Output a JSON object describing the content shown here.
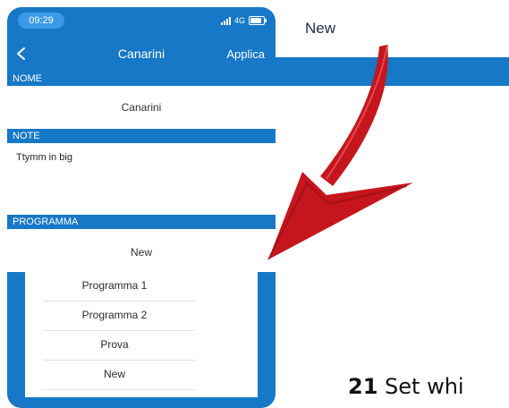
{
  "status_bar": {
    "time": "09:29",
    "network": "4G"
  },
  "nav": {
    "title": "Canarini",
    "apply_label": "Applica"
  },
  "sections": {
    "nome": {
      "label": "NOME",
      "value": "Canarini"
    },
    "note": {
      "label": "NOTE",
      "value": "Ttymm in big"
    },
    "programma": {
      "label": "PROGRAMMA",
      "value": "New"
    }
  },
  "picker": {
    "options": [
      {
        "label": "Programma 1"
      },
      {
        "label": "Programma 2"
      },
      {
        "label": "Prova"
      },
      {
        "label": "New"
      }
    ]
  },
  "zoom": {
    "title": "New"
  },
  "caption": {
    "number": "21",
    "text": "Set whi"
  },
  "colors": {
    "accent": "#1678c6",
    "arrow": "#c4161c"
  }
}
